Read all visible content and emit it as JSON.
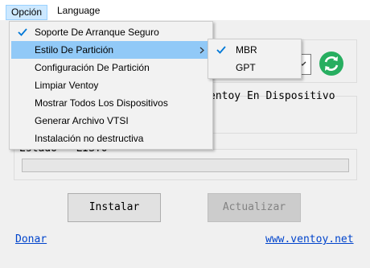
{
  "menubar": {
    "items": [
      {
        "label": "Opción",
        "active": true
      },
      {
        "label": "Language",
        "active": false
      }
    ]
  },
  "option_menu": {
    "items": [
      {
        "label": "Soporte De Arranque Seguro",
        "checked": true,
        "submenu": false
      },
      {
        "label": "Estilo De Partición",
        "checked": false,
        "submenu": true,
        "highlighted": true
      },
      {
        "label": "Configuración De Partición",
        "checked": false,
        "submenu": false
      },
      {
        "label": "Limpiar Ventoy",
        "checked": false,
        "submenu": false
      },
      {
        "label": "Mostrar Todos Los Dispositivos",
        "checked": false,
        "submenu": false
      },
      {
        "label": "Generar Archivo VTSI",
        "checked": false,
        "submenu": false
      },
      {
        "label": "Instalación no destructiva",
        "checked": false,
        "submenu": false
      }
    ]
  },
  "partition_submenu": {
    "items": [
      {
        "label": "MBR",
        "checked": true
      },
      {
        "label": "GPT",
        "checked": false
      }
    ]
  },
  "main": {
    "device_label_partial": "entoy En Dispositivo",
    "status_label": "Estado - LISTO",
    "progress": 0.0,
    "install_button": "Instalar",
    "update_button": "Actualizar",
    "donate_link": "Donar",
    "site_link": "www.ventoy.net"
  },
  "colors": {
    "refresh_icon": "#27ae60",
    "highlight": "#91c9f7",
    "check": "#0078d7",
    "link": "#0044cc"
  }
}
